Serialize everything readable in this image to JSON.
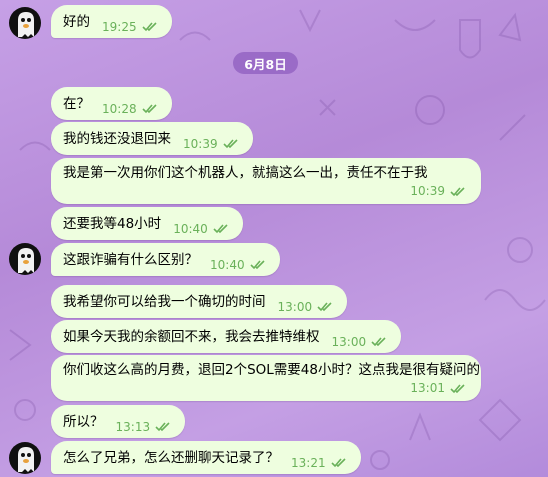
{
  "chat": {
    "date_separator": "6月8日",
    "messages": [
      {
        "text": "好的",
        "time": "19:25"
      },
      {
        "text": "在？",
        "time": "10:28"
      },
      {
        "text": "我的钱还没退回来",
        "time": "10:39"
      },
      {
        "text": "我是第一次用你们这个机器人，就搞这么一出，责任不在于我",
        "time": "10:39"
      },
      {
        "text": "还要我等48小时",
        "time": "10:40"
      },
      {
        "text": "这跟诈骗有什么区别？",
        "time": "10:40"
      },
      {
        "text": "我希望你可以给我一个确切的时间",
        "time": "13:00"
      },
      {
        "text": "如果今天我的余额回不来，我会去推特维权",
        "time": "13:00"
      },
      {
        "text": "你们收这么高的月费，退回2个SOL需要48小时？这点我是很有疑问的",
        "time": "13:01"
      },
      {
        "text": "所以？",
        "time": "13:13"
      },
      {
        "text": "怎么了兄弟，怎么还删聊天记录了？",
        "time": "13:21"
      }
    ]
  },
  "colors": {
    "bubble": "#eefedf",
    "time_text": "#6ab15a",
    "date_pill": "#9a6bc7"
  },
  "icons": {
    "read_receipt": "double-check-icon",
    "avatar": "ghost-avatar"
  }
}
